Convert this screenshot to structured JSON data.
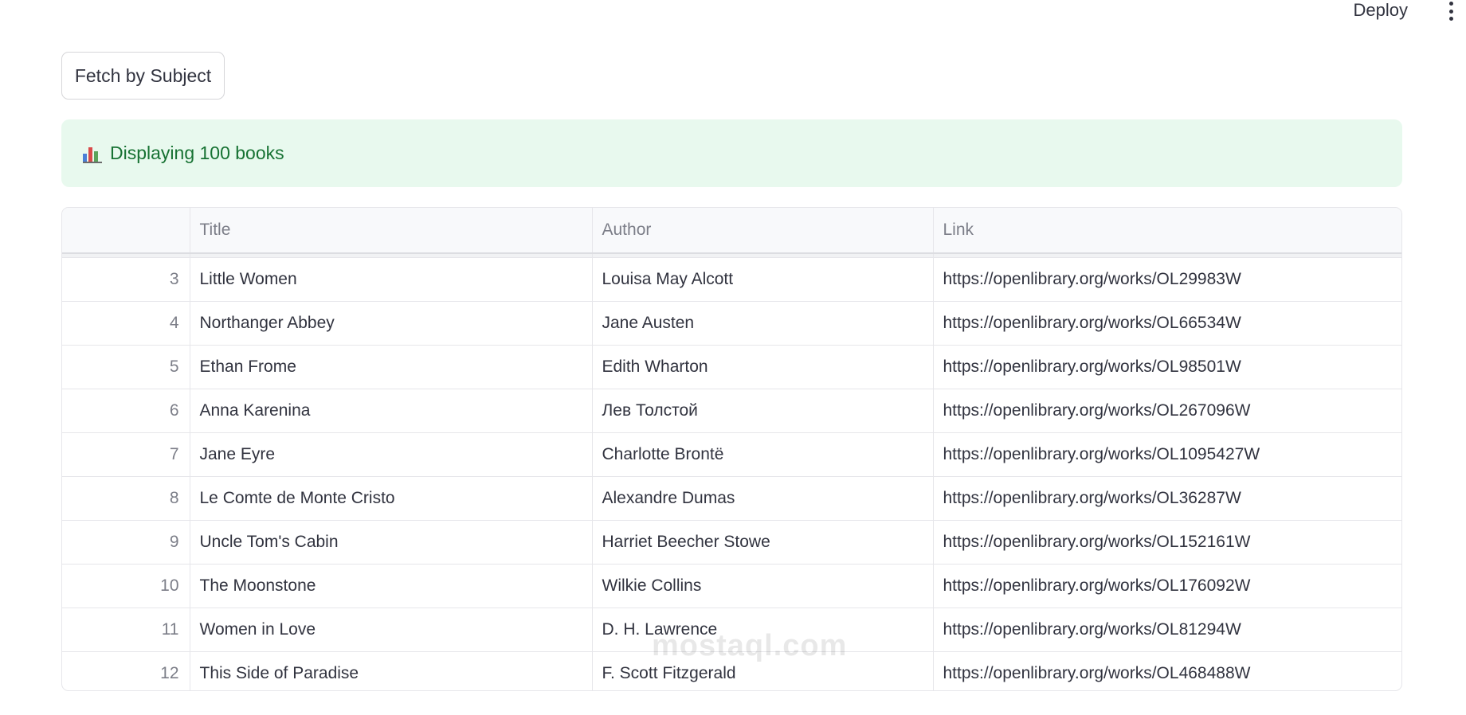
{
  "header": {
    "deploy_label": "Deploy",
    "menu_icon": "kebab-menu-icon"
  },
  "toolbar": {
    "fetch_label": "Fetch by Subject"
  },
  "alert": {
    "icon": "bar-chart-icon",
    "text": "Displaying 100 books",
    "color": "#177233",
    "background": "#e8f9ee"
  },
  "table": {
    "columns": [
      "",
      "Title",
      "Author",
      "Link"
    ],
    "rows": [
      {
        "index": "3",
        "title": "Little Women",
        "author": "Louisa May Alcott",
        "link": "https://openlibrary.org/works/OL29983W"
      },
      {
        "index": "4",
        "title": "Northanger Abbey",
        "author": "Jane Austen",
        "link": "https://openlibrary.org/works/OL66534W"
      },
      {
        "index": "5",
        "title": "Ethan Frome",
        "author": "Edith Wharton",
        "link": "https://openlibrary.org/works/OL98501W"
      },
      {
        "index": "6",
        "title": "Anna Karenina",
        "author": "Лев Толстой",
        "link": "https://openlibrary.org/works/OL267096W"
      },
      {
        "index": "7",
        "title": "Jane Eyre",
        "author": "Charlotte Brontë",
        "link": "https://openlibrary.org/works/OL1095427W"
      },
      {
        "index": "8",
        "title": "Le Comte de Monte Cristo",
        "author": "Alexandre Dumas",
        "link": "https://openlibrary.org/works/OL36287W"
      },
      {
        "index": "9",
        "title": "Uncle Tom's Cabin",
        "author": "Harriet Beecher Stowe",
        "link": "https://openlibrary.org/works/OL152161W"
      },
      {
        "index": "10",
        "title": "The Moonstone",
        "author": "Wilkie Collins",
        "link": "https://openlibrary.org/works/OL176092W"
      },
      {
        "index": "11",
        "title": "Women in Love",
        "author": "D. H. Lawrence",
        "link": "https://openlibrary.org/works/OL81294W"
      },
      {
        "index": "12",
        "title": "This Side of Paradise",
        "author": "F. Scott Fitzgerald",
        "link": "https://openlibrary.org/works/OL468488W"
      }
    ]
  },
  "watermark": {
    "text": "mostaql.com"
  }
}
